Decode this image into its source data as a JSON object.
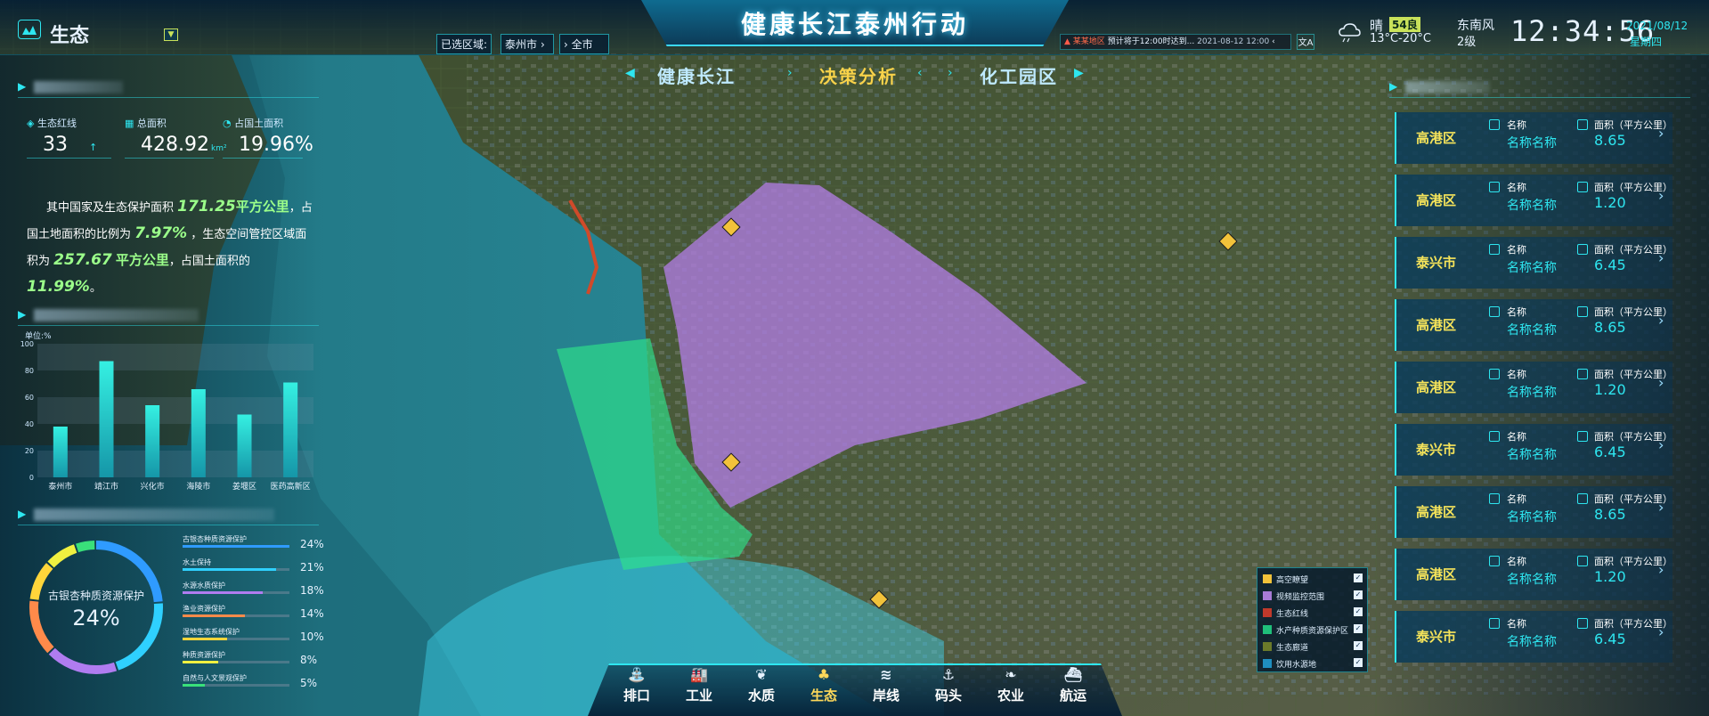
{
  "header": {
    "module_label": "生态",
    "title": "健康长江泰州行动",
    "region_label": "已选区域:",
    "region_city": "泰州市",
    "region_scope": "全市",
    "alert_region": "某某地区",
    "alert_text": "预计将于12:00时达到...",
    "alert_time": "2021-08-12 12:00",
    "weather_text": "晴",
    "aqi": "54良",
    "temp": "13°C-20°C",
    "wind_dir": "东南风",
    "wind_level": "2级",
    "time": "12:34:56",
    "date": "2021/08/12",
    "weekday": "星期四"
  },
  "nav_tabs": [
    {
      "label": "健康长江",
      "active": false
    },
    {
      "label": "决策分析",
      "active": true
    },
    {
      "label": "化工园区",
      "active": false
    }
  ],
  "stats": [
    {
      "label": "生态红线",
      "value": "33",
      "unit": ""
    },
    {
      "label": "总面积",
      "value": "428.92",
      "unit": "km²"
    },
    {
      "label": "占国土面积",
      "value": "19.96%",
      "unit": ""
    }
  ],
  "description": {
    "t1": "其中国家及生态保护面积",
    "v1": "171.25",
    "u1": "平方公里",
    "t2": "，占",
    "t3": "国土地面积的比例为",
    "v2": "7.97%",
    "t4": "，生态空间管控区域面",
    "t5": "积为",
    "v3": "257.67",
    "u3": "平方公里",
    "t6": "，占国土面积的",
    "v4": "11.99%",
    "t7": "。"
  },
  "bar_chart_unit": "单位:%",
  "chart_data": {
    "type": "bar",
    "categories": [
      "泰州市",
      "靖江市",
      "兴化市",
      "海陵市",
      "姜堰区",
      "医药高新区"
    ],
    "values": [
      38,
      87,
      54,
      66,
      47,
      71
    ],
    "ylim": [
      0,
      100
    ],
    "yticks": [
      "0",
      "20",
      "40",
      "60",
      "80",
      "100"
    ]
  },
  "donut": {
    "center_label": "古银杏种质资源保护",
    "center_value": "24%",
    "segments": [
      {
        "name": "古银杏种质资源保护",
        "pct": 24,
        "color": "#2f9bff"
      },
      {
        "name": "水土保持",
        "pct": 21,
        "color": "#2fd0ff"
      },
      {
        "name": "水源水质保护",
        "pct": 18,
        "color": "#b07cf0"
      },
      {
        "name": "渔业资源保护",
        "pct": 14,
        "color": "#ff8a4a"
      },
      {
        "name": "湿地生态系统保护",
        "pct": 10,
        "color": "#ffd53a"
      },
      {
        "name": "种质资源保护",
        "pct": 8,
        "color": "#f0f040"
      },
      {
        "name": "自然与人文景观保护",
        "pct": 5,
        "color": "#39e07a"
      }
    ]
  },
  "right_list": [
    {
      "city": "高港区",
      "name_label": "名称",
      "name_value": "名称名称",
      "area_label": "面积（平方公里）",
      "area_value": "8.65"
    },
    {
      "city": "高港区",
      "name_label": "名称",
      "name_value": "名称名称",
      "area_label": "面积（平方公里）",
      "area_value": "1.20"
    },
    {
      "city": "泰兴市",
      "name_label": "名称",
      "name_value": "名称名称",
      "area_label": "面积（平方公里）",
      "area_value": "6.45"
    },
    {
      "city": "高港区",
      "name_label": "名称",
      "name_value": "名称名称",
      "area_label": "面积（平方公里）",
      "area_value": "8.65"
    },
    {
      "city": "高港区",
      "name_label": "名称",
      "name_value": "名称名称",
      "area_label": "面积（平方公里）",
      "area_value": "1.20"
    },
    {
      "city": "泰兴市",
      "name_label": "名称",
      "name_value": "名称名称",
      "area_label": "面积（平方公里）",
      "area_value": "6.45"
    },
    {
      "city": "高港区",
      "name_label": "名称",
      "name_value": "名称名称",
      "area_label": "面积（平方公里）",
      "area_value": "8.65"
    },
    {
      "city": "高港区",
      "name_label": "名称",
      "name_value": "名称名称",
      "area_label": "面积（平方公里）",
      "area_value": "1.20"
    },
    {
      "city": "泰兴市",
      "name_label": "名称",
      "name_value": "名称名称",
      "area_label": "面积（平方公里）",
      "area_value": "6.45"
    }
  ],
  "map_legend": [
    {
      "label": "高空瞭望",
      "color": "#f2c23a",
      "checked": true
    },
    {
      "label": "视频监控范围",
      "color": "#a77bd6",
      "checked": true
    },
    {
      "label": "生态红线",
      "color": "#c0392b",
      "checked": true
    },
    {
      "label": "水产种质资源保护区",
      "color": "#1fbf7a",
      "checked": true
    },
    {
      "label": "生态廊道",
      "color": "#6b7a2a",
      "checked": true
    },
    {
      "label": "饮用水源地",
      "color": "#1f8fc0",
      "checked": true
    }
  ],
  "bottom_nav": [
    {
      "label": "排口",
      "icon": "outlet-icon",
      "active": false
    },
    {
      "label": "工业",
      "icon": "factory-icon",
      "active": false
    },
    {
      "label": "水质",
      "icon": "water-quality-icon",
      "active": false
    },
    {
      "label": "生态",
      "icon": "ecology-icon",
      "active": true
    },
    {
      "label": "岸线",
      "icon": "shoreline-icon",
      "active": false
    },
    {
      "label": "码头",
      "icon": "anchor-icon",
      "active": false
    },
    {
      "label": "农业",
      "icon": "wheat-icon",
      "active": false
    },
    {
      "label": "航运",
      "icon": "ship-icon",
      "active": false
    }
  ],
  "colors": {
    "accent": "#2ee6f0",
    "highlight": "#f6e45a",
    "positive": "#9bff8a",
    "purple_zone": "#b07ce0",
    "green_zone": "#2ee38a"
  }
}
